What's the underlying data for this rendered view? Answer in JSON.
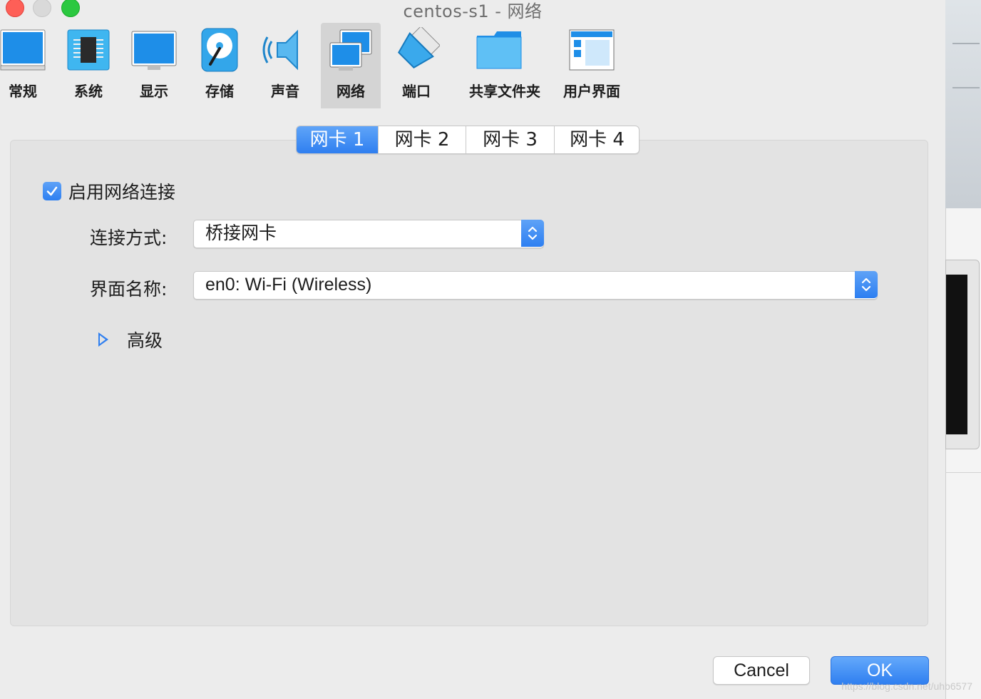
{
  "window": {
    "title": "centos-s1 - 网络"
  },
  "toolbar": {
    "items": [
      {
        "label": "常规",
        "icon": "general-icon"
      },
      {
        "label": "系统",
        "icon": "system-chip-icon"
      },
      {
        "label": "显示",
        "icon": "display-monitor-icon"
      },
      {
        "label": "存储",
        "icon": "storage-disk-icon"
      },
      {
        "label": "声音",
        "icon": "speaker-icon"
      },
      {
        "label": "网络",
        "icon": "network-icon",
        "selected": true
      },
      {
        "label": "端口",
        "icon": "serial-port-icon"
      },
      {
        "label": "共享文件夹",
        "icon": "shared-folder-icon"
      },
      {
        "label": "用户界面",
        "icon": "user-interface-icon"
      }
    ]
  },
  "adapter_tabs": [
    {
      "label": "网卡 1",
      "active": true
    },
    {
      "label": "网卡 2"
    },
    {
      "label": "网卡 3"
    },
    {
      "label": "网卡 4"
    }
  ],
  "form": {
    "enable_label": "启用网络连接",
    "enable_checked": true,
    "attached_label": "连接方式:",
    "attached_value": "桥接网卡",
    "interface_label": "界面名称:",
    "interface_value": "en0: Wi-Fi (Wireless)",
    "advanced_label": "高级"
  },
  "buttons": {
    "cancel": "Cancel",
    "ok": "OK"
  },
  "watermark": "https://blog.csdn.net/uhb6577",
  "colors": {
    "accent": "#2f7ff0",
    "panel": "#e3e3e3",
    "window": "#ececec"
  }
}
